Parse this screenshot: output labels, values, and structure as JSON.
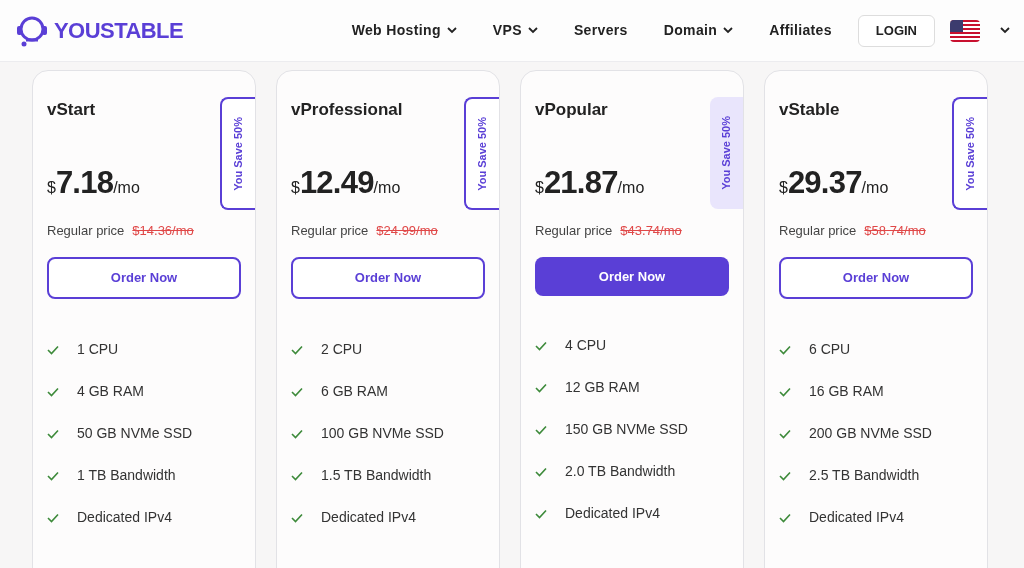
{
  "brand": {
    "name": "YOUSTABLE"
  },
  "nav": [
    {
      "label": "Web Hosting",
      "dropdown": true
    },
    {
      "label": "VPS",
      "dropdown": true
    },
    {
      "label": "Servers",
      "dropdown": false
    },
    {
      "label": "Domain",
      "dropdown": true
    },
    {
      "label": "Affiliates",
      "dropdown": false
    }
  ],
  "login": "LOGIN",
  "plans": [
    {
      "name": "vStart",
      "currency": "$",
      "price": "7.18",
      "period": "/mo",
      "badge": "You Save 50%",
      "featured": false,
      "regular_label": "Regular price",
      "regular_price": "$14.36/mo",
      "button": "Order Now",
      "features": [
        "1 CPU",
        "4 GB RAM",
        "50 GB NVMe SSD",
        "1 TB Bandwidth",
        "Dedicated IPv4"
      ]
    },
    {
      "name": "vProfessional",
      "currency": "$",
      "price": "12.49",
      "period": "/mo",
      "badge": "You Save 50%",
      "featured": false,
      "regular_label": "Regular price",
      "regular_price": "$24.99/mo",
      "button": "Order Now",
      "features": [
        "2 CPU",
        "6 GB RAM",
        "100 GB NVMe SSD",
        "1.5 TB Bandwidth",
        "Dedicated IPv4"
      ]
    },
    {
      "name": "vPopular",
      "currency": "$",
      "price": "21.87",
      "period": "/mo",
      "badge": "You Save 50%",
      "featured": true,
      "regular_label": "Regular price",
      "regular_price": "$43.74/mo",
      "button": "Order Now",
      "features": [
        "4 CPU",
        "12 GB RAM",
        "150 GB NVMe SSD",
        "2.0 TB Bandwidth",
        "Dedicated IPv4"
      ]
    },
    {
      "name": "vStable",
      "currency": "$",
      "price": "29.37",
      "period": "/mo",
      "badge": "You Save 50%",
      "featured": false,
      "regular_label": "Regular price",
      "regular_price": "$58.74/mo",
      "button": "Order Now",
      "features": [
        "6 CPU",
        "16 GB RAM",
        "200 GB NVMe SSD",
        "2.5 TB Bandwidth",
        "Dedicated IPv4"
      ]
    }
  ]
}
